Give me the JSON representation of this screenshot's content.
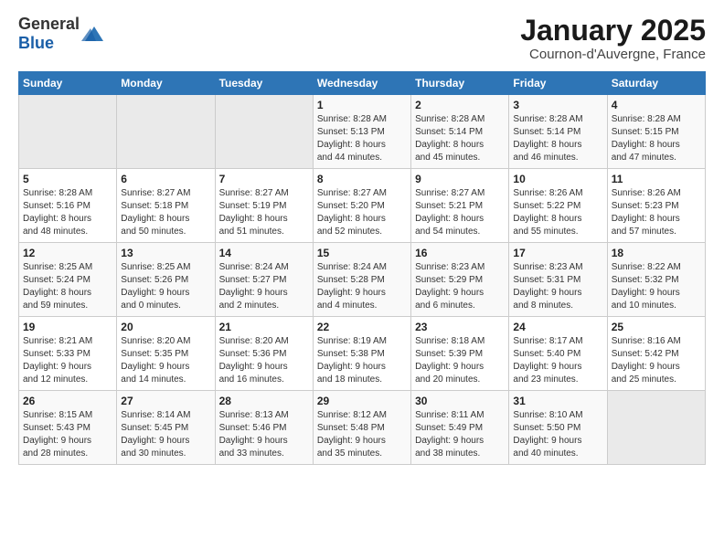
{
  "logo": {
    "general": "General",
    "blue": "Blue"
  },
  "title": "January 2025",
  "subtitle": "Cournon-d'Auvergne, France",
  "headers": [
    "Sunday",
    "Monday",
    "Tuesday",
    "Wednesday",
    "Thursday",
    "Friday",
    "Saturday"
  ],
  "weeks": [
    [
      {
        "day": "",
        "info": ""
      },
      {
        "day": "",
        "info": ""
      },
      {
        "day": "",
        "info": ""
      },
      {
        "day": "1",
        "info": "Sunrise: 8:28 AM\nSunset: 5:13 PM\nDaylight: 8 hours\nand 44 minutes."
      },
      {
        "day": "2",
        "info": "Sunrise: 8:28 AM\nSunset: 5:14 PM\nDaylight: 8 hours\nand 45 minutes."
      },
      {
        "day": "3",
        "info": "Sunrise: 8:28 AM\nSunset: 5:14 PM\nDaylight: 8 hours\nand 46 minutes."
      },
      {
        "day": "4",
        "info": "Sunrise: 8:28 AM\nSunset: 5:15 PM\nDaylight: 8 hours\nand 47 minutes."
      }
    ],
    [
      {
        "day": "5",
        "info": "Sunrise: 8:28 AM\nSunset: 5:16 PM\nDaylight: 8 hours\nand 48 minutes."
      },
      {
        "day": "6",
        "info": "Sunrise: 8:27 AM\nSunset: 5:18 PM\nDaylight: 8 hours\nand 50 minutes."
      },
      {
        "day": "7",
        "info": "Sunrise: 8:27 AM\nSunset: 5:19 PM\nDaylight: 8 hours\nand 51 minutes."
      },
      {
        "day": "8",
        "info": "Sunrise: 8:27 AM\nSunset: 5:20 PM\nDaylight: 8 hours\nand 52 minutes."
      },
      {
        "day": "9",
        "info": "Sunrise: 8:27 AM\nSunset: 5:21 PM\nDaylight: 8 hours\nand 54 minutes."
      },
      {
        "day": "10",
        "info": "Sunrise: 8:26 AM\nSunset: 5:22 PM\nDaylight: 8 hours\nand 55 minutes."
      },
      {
        "day": "11",
        "info": "Sunrise: 8:26 AM\nSunset: 5:23 PM\nDaylight: 8 hours\nand 57 minutes."
      }
    ],
    [
      {
        "day": "12",
        "info": "Sunrise: 8:25 AM\nSunset: 5:24 PM\nDaylight: 8 hours\nand 59 minutes."
      },
      {
        "day": "13",
        "info": "Sunrise: 8:25 AM\nSunset: 5:26 PM\nDaylight: 9 hours\nand 0 minutes."
      },
      {
        "day": "14",
        "info": "Sunrise: 8:24 AM\nSunset: 5:27 PM\nDaylight: 9 hours\nand 2 minutes."
      },
      {
        "day": "15",
        "info": "Sunrise: 8:24 AM\nSunset: 5:28 PM\nDaylight: 9 hours\nand 4 minutes."
      },
      {
        "day": "16",
        "info": "Sunrise: 8:23 AM\nSunset: 5:29 PM\nDaylight: 9 hours\nand 6 minutes."
      },
      {
        "day": "17",
        "info": "Sunrise: 8:23 AM\nSunset: 5:31 PM\nDaylight: 9 hours\nand 8 minutes."
      },
      {
        "day": "18",
        "info": "Sunrise: 8:22 AM\nSunset: 5:32 PM\nDaylight: 9 hours\nand 10 minutes."
      }
    ],
    [
      {
        "day": "19",
        "info": "Sunrise: 8:21 AM\nSunset: 5:33 PM\nDaylight: 9 hours\nand 12 minutes."
      },
      {
        "day": "20",
        "info": "Sunrise: 8:20 AM\nSunset: 5:35 PM\nDaylight: 9 hours\nand 14 minutes."
      },
      {
        "day": "21",
        "info": "Sunrise: 8:20 AM\nSunset: 5:36 PM\nDaylight: 9 hours\nand 16 minutes."
      },
      {
        "day": "22",
        "info": "Sunrise: 8:19 AM\nSunset: 5:38 PM\nDaylight: 9 hours\nand 18 minutes."
      },
      {
        "day": "23",
        "info": "Sunrise: 8:18 AM\nSunset: 5:39 PM\nDaylight: 9 hours\nand 20 minutes."
      },
      {
        "day": "24",
        "info": "Sunrise: 8:17 AM\nSunset: 5:40 PM\nDaylight: 9 hours\nand 23 minutes."
      },
      {
        "day": "25",
        "info": "Sunrise: 8:16 AM\nSunset: 5:42 PM\nDaylight: 9 hours\nand 25 minutes."
      }
    ],
    [
      {
        "day": "26",
        "info": "Sunrise: 8:15 AM\nSunset: 5:43 PM\nDaylight: 9 hours\nand 28 minutes."
      },
      {
        "day": "27",
        "info": "Sunrise: 8:14 AM\nSunset: 5:45 PM\nDaylight: 9 hours\nand 30 minutes."
      },
      {
        "day": "28",
        "info": "Sunrise: 8:13 AM\nSunset: 5:46 PM\nDaylight: 9 hours\nand 33 minutes."
      },
      {
        "day": "29",
        "info": "Sunrise: 8:12 AM\nSunset: 5:48 PM\nDaylight: 9 hours\nand 35 minutes."
      },
      {
        "day": "30",
        "info": "Sunrise: 8:11 AM\nSunset: 5:49 PM\nDaylight: 9 hours\nand 38 minutes."
      },
      {
        "day": "31",
        "info": "Sunrise: 8:10 AM\nSunset: 5:50 PM\nDaylight: 9 hours\nand 40 minutes."
      },
      {
        "day": "",
        "info": ""
      }
    ]
  ]
}
